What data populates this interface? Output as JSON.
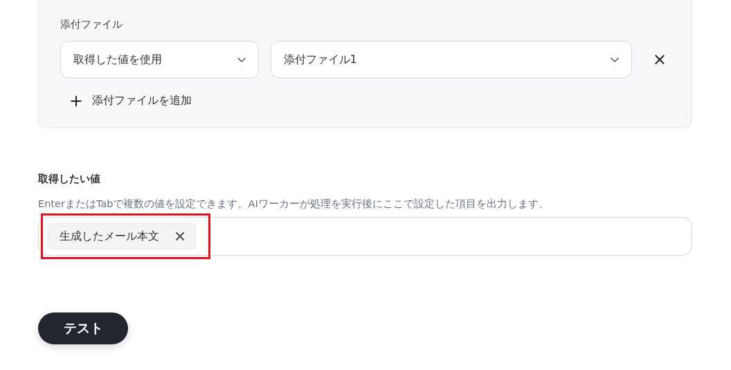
{
  "attachments": {
    "label": "添付ファイル",
    "rows": [
      {
        "source": "取得した値を使用",
        "value": "添付ファイル1"
      }
    ],
    "add_button": "添付ファイルを追加"
  },
  "values_field": {
    "label": "取得したい値",
    "help": "EnterまたはTabで複数の値を設定できます。AIワーカーが処理を実行後にここで設定した項目を出力します。",
    "tags": [
      {
        "text": "生成したメール本文",
        "highlighted": true
      }
    ]
  },
  "test_button": "テスト"
}
